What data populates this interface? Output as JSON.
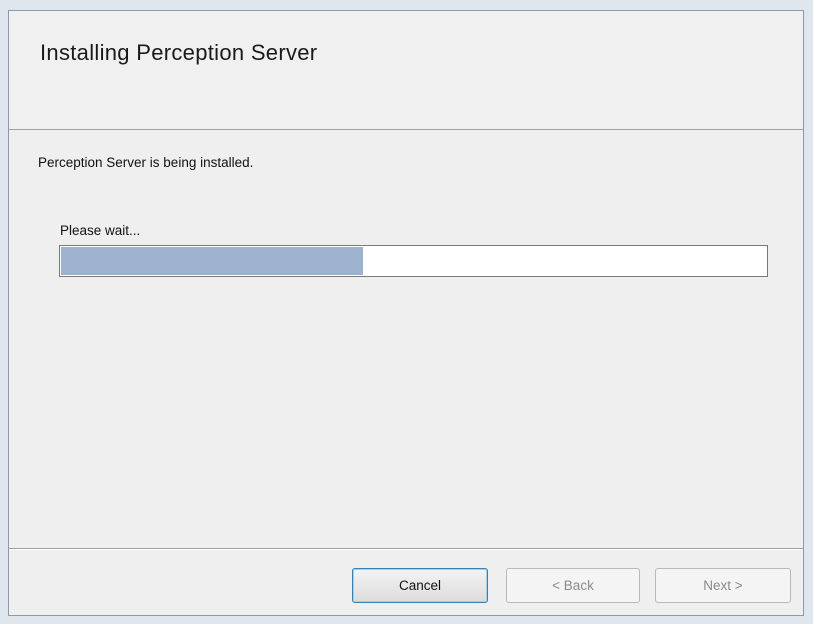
{
  "header": {
    "title": "Installing Perception Server"
  },
  "body": {
    "status_text": "Perception Server is being installed.",
    "wait_label": "Please wait...",
    "progress_fraction": 0.43
  },
  "footer": {
    "cancel_label": "Cancel",
    "back_label": "< Back",
    "next_label": "Next >"
  },
  "colors": {
    "progress_fill": "#9db2cd",
    "cancel_border": "#3c7fb1"
  }
}
